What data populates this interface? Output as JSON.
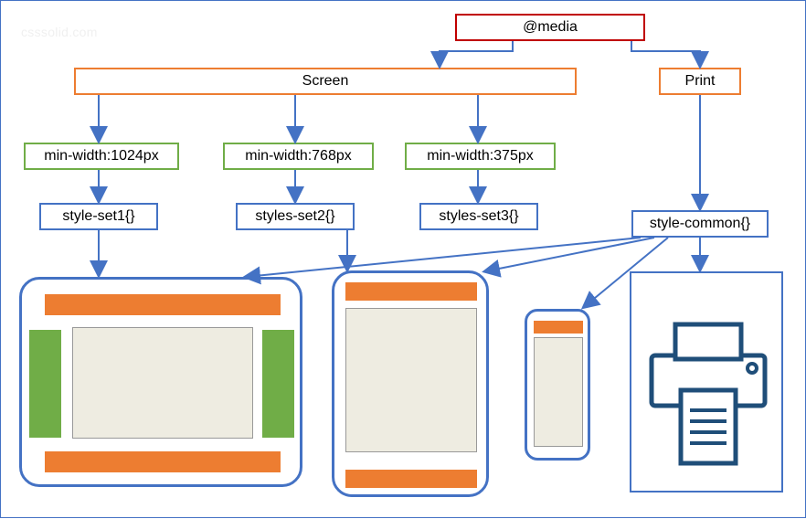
{
  "root": {
    "label": "@media"
  },
  "screen": {
    "label": "Screen"
  },
  "print": {
    "label": "Print"
  },
  "bp1": {
    "label": "min-width:1024px"
  },
  "bp2": {
    "label": "min-width:768px"
  },
  "bp3": {
    "label": "min-width:375px"
  },
  "set1": {
    "label": "style-set1{}"
  },
  "set2": {
    "label": "styles-set2{}"
  },
  "set3": {
    "label": "styles-set3{}"
  },
  "common": {
    "label": "style-common{}"
  },
  "watermark": "csssolid.com"
}
